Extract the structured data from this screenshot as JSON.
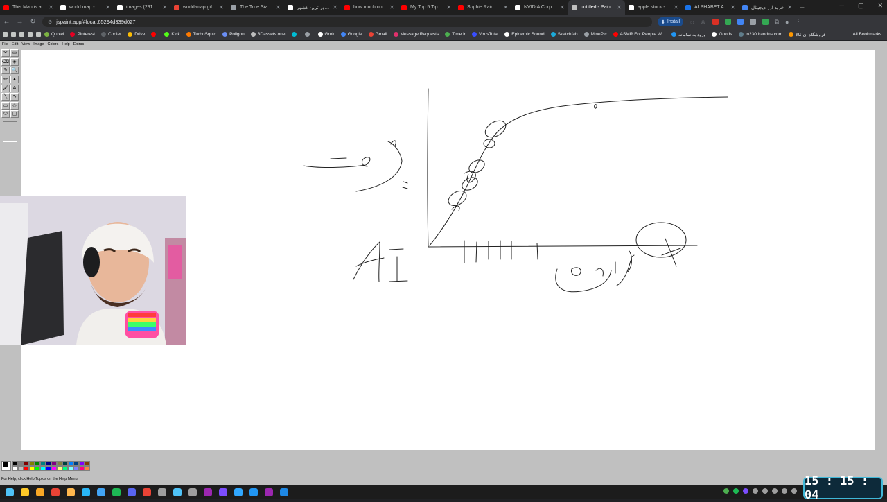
{
  "browser": {
    "tabs": [
      {
        "label": "This Man is a Ma",
        "color": "#ff0000",
        "active": false
      },
      {
        "label": "world map - Goo",
        "color": "#ffffff",
        "active": false
      },
      {
        "label": "images (291×173",
        "color": "#ffffff",
        "active": false
      },
      {
        "label": "world-map.gif (13",
        "color": "#ea4335",
        "active": false
      },
      {
        "label": "The True Size Of",
        "color": "#9aa0a6",
        "active": false
      },
      {
        "label": "پهناور ترین کشور",
        "color": "#ffffff",
        "active": false
      },
      {
        "label": "how much only t",
        "color": "#ff0000",
        "active": false
      },
      {
        "label": "My Top 5 Tip",
        "color": "#ff0000",
        "active": false
      },
      {
        "label": "Sophie Rain reve",
        "color": "#ff0000",
        "active": false
      },
      {
        "label": "NVIDIA Corporati",
        "color": "#ffffff",
        "active": false
      },
      {
        "label": "untitled - Paint",
        "color": "#c0c0c0",
        "active": true
      },
      {
        "label": "apple stock - Goo",
        "color": "#ffffff",
        "active": false
      },
      {
        "label": "ALPHABET A (EI",
        "color": "#1a73e8",
        "active": false
      },
      {
        "label": "خرید ارز دیجیتال",
        "color": "#4285f4",
        "active": false
      }
    ],
    "new_tab": "+",
    "url": "jspaint.app/#local:65294d339d027",
    "install_label": "Install",
    "bookmarks": [
      {
        "label": "Quixel",
        "color": "#7cb342"
      },
      {
        "label": "Pinterest",
        "color": "#e60023"
      },
      {
        "label": "Cooler",
        "color": "#5f6368"
      },
      {
        "label": "Drive",
        "color": "#fbbc04"
      },
      {
        "label": "",
        "color": "#ff0000"
      },
      {
        "label": "Kick",
        "color": "#53fc18"
      },
      {
        "label": "TurboSquid",
        "color": "#ff7a00"
      },
      {
        "label": "Poligon",
        "color": "#6a8ef5"
      },
      {
        "label": "3Dassets.one",
        "color": "#bdbdbd"
      },
      {
        "label": "",
        "color": "#00bcd4"
      },
      {
        "label": "",
        "color": "#9aa0a6"
      },
      {
        "label": "Grok",
        "color": "#ffffff"
      },
      {
        "label": "Google",
        "color": "#4285f4"
      },
      {
        "label": "Gmail",
        "color": "#ea4335"
      },
      {
        "label": "Message Requests",
        "color": "#e1306c"
      },
      {
        "label": "Time.ir",
        "color": "#4caf50"
      },
      {
        "label": "VirusTotal",
        "color": "#394eff"
      },
      {
        "label": "Epidemic Sound",
        "color": "#ffffff"
      },
      {
        "label": "Sketchfab",
        "color": "#1caad9"
      },
      {
        "label": "MinePic",
        "color": "#9aa0a6"
      },
      {
        "label": "ASMR For People W...",
        "color": "#ff0000"
      },
      {
        "label": "ورود به سامانه",
        "color": "#2196f3"
      },
      {
        "label": "Goods",
        "color": "#ffffff"
      },
      {
        "label": "In230.irandns.com",
        "color": "#607d8b"
      },
      {
        "label": "فروشگاه ان کالا",
        "color": "#ff9800"
      }
    ],
    "all_bookmarks": "All Bookmarks"
  },
  "paint": {
    "menu": [
      "File",
      "Edit",
      "View",
      "Image",
      "Colors",
      "Help",
      "Extras"
    ],
    "tools": [
      "✂",
      "▭",
      "⌫",
      "◈",
      "✎",
      "🔍",
      "✏",
      "▲",
      "🖌",
      "A",
      "╲",
      "∿",
      "▭",
      "◇",
      "⬭",
      "▢"
    ],
    "palette": [
      "#000000",
      "#808080",
      "#800000",
      "#808000",
      "#008000",
      "#008080",
      "#000080",
      "#800080",
      "#808040",
      "#004040",
      "#0080ff",
      "#004080",
      "#8000ff",
      "#804000",
      "#ffffff",
      "#c0c0c0",
      "#ff0000",
      "#ffff00",
      "#00ff00",
      "#00ffff",
      "#0000ff",
      "#ff00ff",
      "#ffff80",
      "#00ff80",
      "#80ffff",
      "#8080ff",
      "#ff0080",
      "#ff8040"
    ],
    "status": "For Help, click Help Topics on the Help Menu.",
    "drawing": {
      "y_axis_label": "بشریت",
      "x_axis_label": "زمان",
      "ai_label": "AI"
    }
  },
  "clock": "15 : 15 : 04"
}
